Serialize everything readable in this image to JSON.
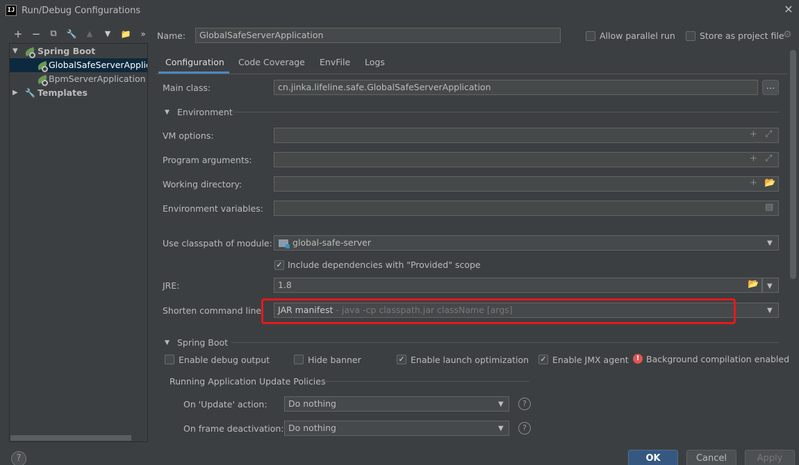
{
  "window": {
    "title": "Run/Debug Configurations",
    "app_icon_text": "IJ"
  },
  "toolbar": {
    "add": "+",
    "remove": "−",
    "copy": "⧉",
    "edit": "🔧",
    "up": "▲",
    "down": "▼",
    "folder": "📁",
    "more": "»"
  },
  "tree": {
    "spring_boot": "Spring Boot",
    "items": [
      "GlobalSafeServerApplica",
      "BpmServerApplication"
    ],
    "templates": "Templates"
  },
  "header": {
    "name_label": "Name:",
    "name_value": "GlobalSafeServerApplication",
    "allow_parallel": "Allow parallel run",
    "store_project": "Store as project file"
  },
  "tabs": [
    "Configuration",
    "Code Coverage",
    "EnvFile",
    "Logs"
  ],
  "form": {
    "main_class_label": "Main class:",
    "main_class_value": "cn.jinka.lifeline.safe.GlobalSafeServerApplication",
    "browse": "...",
    "environment": "Environment",
    "vm_options": "VM options:",
    "program_args": "Program arguments:",
    "working_dir": "Working directory:",
    "env_vars": "Environment variables:",
    "classpath_label": "Use classpath of module:",
    "classpath_value": "global-safe-server",
    "include_deps": "Include dependencies with \"Provided\" scope",
    "jre_label": "JRE:",
    "jre_value": "1.8",
    "shorten_label": "Shorten command line:",
    "shorten_value": "JAR manifest",
    "shorten_hint": " - java -cp classpath.jar className [args]"
  },
  "spring": {
    "section": "Spring Boot",
    "debug_output": "Enable debug output",
    "hide_banner": "Hide banner",
    "launch_opt": "Enable launch optimization",
    "jmx": "Enable JMX agent",
    "bg_compile": "Background compilation enabled",
    "policies_title": "Running Application Update Policies",
    "update_label": "On 'Update' action:",
    "update_value": "Do nothing",
    "frame_label": "On frame deactivation:",
    "frame_value": "Do nothing"
  },
  "buttons": {
    "ok": "OK",
    "cancel": "Cancel",
    "apply": "Apply",
    "help": "?"
  }
}
